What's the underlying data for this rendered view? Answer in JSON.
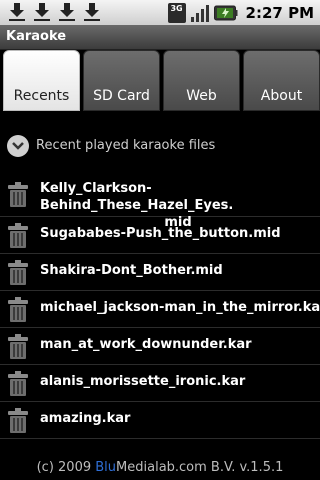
{
  "status": {
    "time": "2:27 PM",
    "network": "3G"
  },
  "app": {
    "title": "Karaoke"
  },
  "tabs": [
    {
      "label": "Recents",
      "active": true
    },
    {
      "label": "SD Card",
      "active": false
    },
    {
      "label": "Web",
      "active": false
    },
    {
      "label": "About",
      "active": false
    }
  ],
  "section": {
    "label": "Recent played karaoke files"
  },
  "files": [
    {
      "name": "Kelly_Clarkson-Behind_These_Hazel_Eyes.",
      "name_line2": "mid"
    },
    {
      "name": "Sugababes-Push_the_button.mid"
    },
    {
      "name": "Shakira-Dont_Bother.mid"
    },
    {
      "name": "michael_jackson-man_in_the_mirror.kar"
    },
    {
      "name": "man_at_work_downunder.kar"
    },
    {
      "name": "alanis_morissette_ironic.kar"
    },
    {
      "name": "amazing.kar"
    }
  ],
  "footer": {
    "prefix": "(c) 2009 ",
    "brand_blu": "Blu",
    "brand_rest": "Medialab.com B.V. v.1.5.1"
  }
}
